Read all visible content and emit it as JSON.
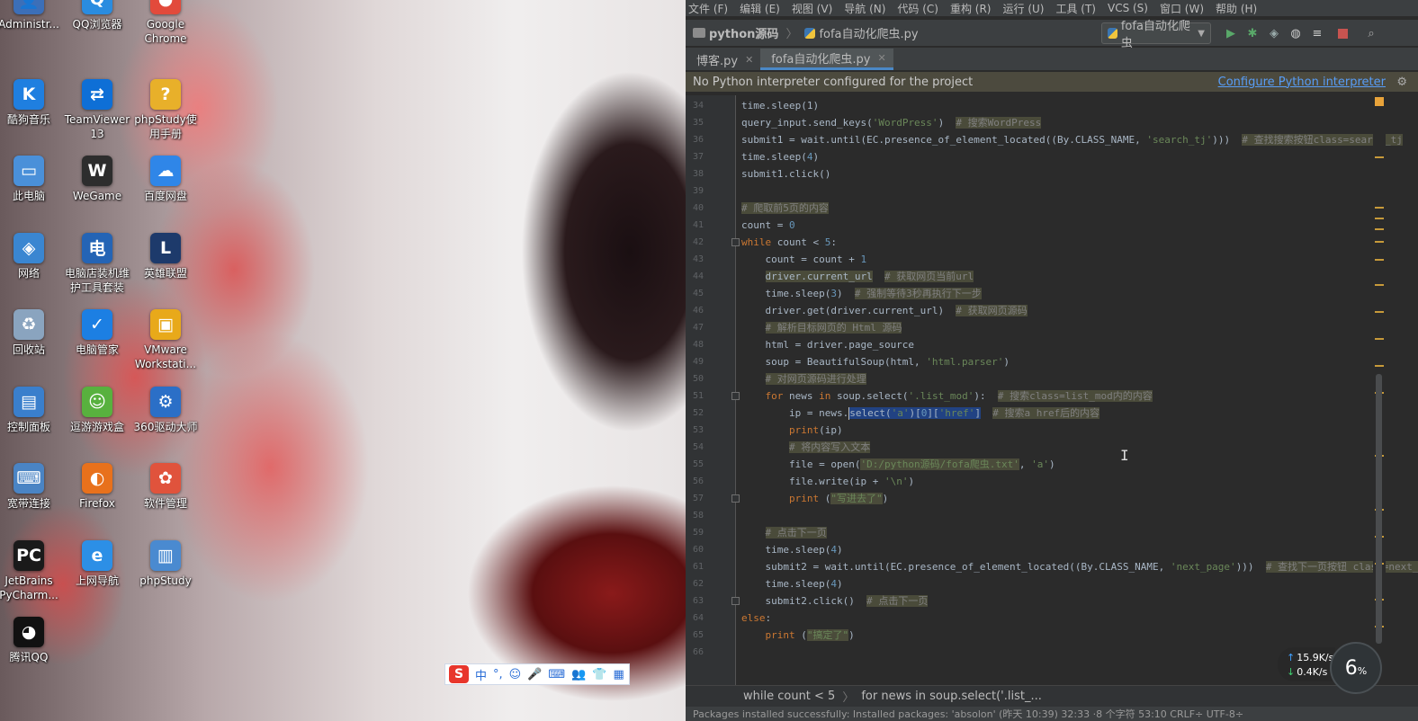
{
  "desktop": {
    "icons": [
      {
        "label": "Administr...",
        "glyph": "👤",
        "color": "#3c6fb8"
      },
      {
        "label": "QQ浏览器",
        "glyph": "Q",
        "color": "#2a8ce0"
      },
      {
        "label": "Google\nChrome",
        "glyph": "●",
        "color": "#e24a3b"
      },
      {
        "label": "酷狗音乐",
        "glyph": "K",
        "color": "#1f7fe0"
      },
      {
        "label": "TeamViewer\n13",
        "glyph": "⇄",
        "color": "#0e6fd6"
      },
      {
        "label": "phpStudy使\n用手册",
        "glyph": "?",
        "color": "#e8b02a"
      },
      {
        "label": "此电脑",
        "glyph": "▭",
        "color": "#4a90d9"
      },
      {
        "label": "WeGame",
        "glyph": "W",
        "color": "#2d2d2d"
      },
      {
        "label": "百度网盘",
        "glyph": "☁",
        "color": "#2f86e8"
      },
      {
        "label": "网络",
        "glyph": "◈",
        "color": "#3a86d1"
      },
      {
        "label": "电脑店装机维\n护工具套装",
        "glyph": "电",
        "color": "#2464b5"
      },
      {
        "label": "英雄联盟",
        "glyph": "L",
        "color": "#1d3a6b"
      },
      {
        "label": "回收站",
        "glyph": "♻",
        "color": "#8aa4bf"
      },
      {
        "label": "电脑管家",
        "glyph": "✓",
        "color": "#1c7fe3"
      },
      {
        "label": "VMware\nWorkstati...",
        "glyph": "▣",
        "color": "#e8a91a"
      },
      {
        "label": "控制面板",
        "glyph": "▤",
        "color": "#3a7fcc"
      },
      {
        "label": "逗游游戏盒",
        "glyph": "☺",
        "color": "#58b13e"
      },
      {
        "label": "360驱动大师",
        "glyph": "⚙",
        "color": "#2b6fc7"
      },
      {
        "label": "宽带连接",
        "glyph": "⌨",
        "color": "#4a84c4"
      },
      {
        "label": "Firefox",
        "glyph": "◐",
        "color": "#e8711c"
      },
      {
        "label": "软件管理",
        "glyph": "✿",
        "color": "#e0533c"
      },
      {
        "label": "JetBrains\nPyCharm...",
        "glyph": "PC",
        "color": "#1a1a1a"
      },
      {
        "label": "上网导航",
        "glyph": "e",
        "color": "#2c8fe6"
      },
      {
        "label": "phpStudy",
        "glyph": "▥",
        "color": "#4a8ad0"
      },
      {
        "label": "腾讯QQ",
        "glyph": "◕",
        "color": "#111111"
      }
    ],
    "ime": {
      "mode": "中",
      "punct": "°,",
      "items": [
        "☺",
        "🎤",
        "⌨",
        "👥",
        "👕",
        "▦"
      ]
    }
  },
  "ide": {
    "menu": [
      "文件 (F)",
      "编辑 (E)",
      "视图 (V)",
      "导航 (N)",
      "代码 (C)",
      "重构 (R)",
      "运行 (U)",
      "工具 (T)",
      "VCS (S)",
      "窗口 (W)",
      "帮助 (H)"
    ],
    "breadcrumb": {
      "project": "python源码",
      "file": "fofa自动化爬虫.py"
    },
    "run_config": "fofa自动化爬虫",
    "tabs": [
      {
        "label": "博客.py",
        "active": false
      },
      {
        "label": "fofa自动化爬虫.py",
        "active": true
      }
    ],
    "notice": {
      "text": "No Python interpreter configured for the project",
      "link": "Configure Python interpreter"
    },
    "code_breadcrumb": [
      "while count < 5",
      "for news in soup.select('.list_..."
    ],
    "status_text": "Packages installed successfully: Installed packages: 'absolon' (昨天 10:39)        32:33  ·8 个字符      53:10   CRLF÷   UTF-8÷",
    "net": {
      "up": "15.9K/s",
      "down": "0.4K/s",
      "percent": "6"
    },
    "lines": [
      {
        "n": "34",
        "html": "time.sleep(1)"
      },
      {
        "n": "35",
        "html": "query_input.send_keys(<span class='str'>'WordPress'</span>)  <span class='cm'># 搜索WordPress</span>"
      },
      {
        "n": "36",
        "html": "submit1 = wait.until(EC.presence_of_element_located((By.CLASS_NAME, <span class='str'>'search_tj'</span>)))  <span class='cm'># 查找搜索按钮class=search_tj</span>"
      },
      {
        "n": "37",
        "html": "time.sleep(<span class='num'>4</span>)"
      },
      {
        "n": "38",
        "html": "submit1.click()"
      },
      {
        "n": "39",
        "html": ""
      },
      {
        "n": "40",
        "html": "<span class='cm'># 爬取前5页的内容</span>"
      },
      {
        "n": "41",
        "html": "count = <span class='num'>0</span>"
      },
      {
        "n": "42",
        "html": "<span class='kw'>while</span> count &lt; <span class='num'>5</span>:"
      },
      {
        "n": "43",
        "html": "    count = count + <span class='num'>1</span>"
      },
      {
        "n": "44",
        "html": "    <span class='hl'>driver.current_url</span>  <span class='cm'># 获取网页当前url</span>"
      },
      {
        "n": "45",
        "html": "    time.sleep(<span class='num'>3</span>)  <span class='cm'># 强制等待3秒再执行下一步</span>"
      },
      {
        "n": "46",
        "html": "    driver.get(driver.current_url)  <span class='cm'># 获取网页源码</span>"
      },
      {
        "n": "47",
        "html": "    <span class='cm'># 解析目标网页的 Html 源码</span>"
      },
      {
        "n": "48",
        "html": "    html = driver.page_source"
      },
      {
        "n": "49",
        "html": "    soup = BeautifulSoup(html, <span class='str'>'html.parser'</span>)"
      },
      {
        "n": "50",
        "html": "    <span class='cm'># 对网页源码进行处理</span>"
      },
      {
        "n": "51",
        "html": "    <span class='kw'>for</span> news <span class='kw'>in</span> soup.select(<span class='str'>'.list_mod'</span>):  <span class='cm'># 搜索class=list_mod内的内容</span>"
      },
      {
        "n": "52",
        "html": "        ip = news.<span class='caret-bar'></span><span class='sel'>select(<span class='str'>'a'</span>)[<span class='num'>0</span>][<span class='str'>'href'</span>]</span>  <span class='cm'># 搜索a href后的内容</span>"
      },
      {
        "n": "53",
        "html": "        <span class='kw'>print</span>(ip)"
      },
      {
        "n": "54",
        "html": "        <span class='cm'># 将内容写入文本</span>"
      },
      {
        "n": "55",
        "html": "        file = open(<span class='str'><span class='hl'>'D:/python源码/fofa爬虫.txt'</span></span>, <span class='str'>'a'</span>)"
      },
      {
        "n": "56",
        "html": "        file.write(ip + <span class='str'>'\\n'</span>)"
      },
      {
        "n": "57",
        "html": "        <span class='kw'>print</span> (<span class='str hl'>\"写进去了\"</span>)"
      },
      {
        "n": "58",
        "html": ""
      },
      {
        "n": "59",
        "html": "    <span class='cm'># 点击下一页</span>"
      },
      {
        "n": "60",
        "html": "    time.sleep(<span class='num'>4</span>)"
      },
      {
        "n": "61",
        "html": "    submit2 = wait.until(EC.presence_of_element_located((By.CLASS_NAME, <span class='str'>'next_page'</span>)))  <span class='cm'># 查找下一页按钮 class=next_page</span>"
      },
      {
        "n": "62",
        "html": "    time.sleep(<span class='num'>4</span>)"
      },
      {
        "n": "63",
        "html": "    submit2.click()  <span class='cm'># 点击下一页</span>"
      },
      {
        "n": "64",
        "html": "<span class='kw'>else</span>:"
      },
      {
        "n": "65",
        "html": "    <span class='kw'>print</span> (<span class='str hl'>\"搞定了\"</span>)"
      },
      {
        "n": "66",
        "html": ""
      }
    ]
  }
}
